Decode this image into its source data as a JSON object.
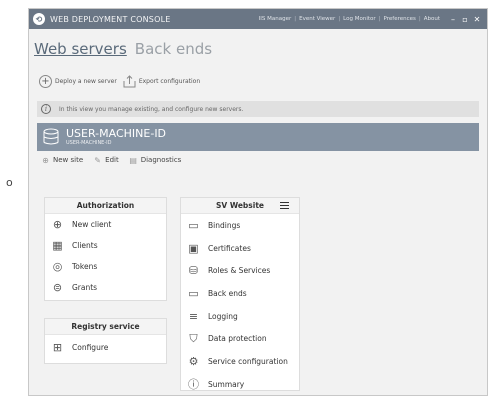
{
  "window": {
    "title": "WEB DEPLOYMENT CONSOLE",
    "top_links": [
      "IIS Manager",
      "Event Viewer",
      "Log Monitor",
      "Preferences",
      "About"
    ],
    "controls": [
      "–",
      "▫",
      "✕"
    ]
  },
  "tabs": [
    {
      "label": "Web servers",
      "active": true
    },
    {
      "label": "Back ends",
      "active": false
    }
  ],
  "toolbar": {
    "deploy_label": "Deploy a new server",
    "export_label": "Export configuration"
  },
  "info": {
    "text": "In this view you manage existing, and configure new servers."
  },
  "machine": {
    "title": "USER-MACHINE-ID",
    "subtitle": "USER-MACHINE-ID"
  },
  "actions": [
    {
      "label": "New site",
      "icon": "plus-circle-icon"
    },
    {
      "label": "Edit",
      "icon": "edit-icon"
    },
    {
      "label": "Diagnostics",
      "icon": "diagnostics-icon"
    }
  ],
  "panels": {
    "authorization": {
      "title": "Authorization",
      "items": [
        {
          "label": "New client",
          "icon": "add-circle-icon"
        },
        {
          "label": "Clients",
          "icon": "grid-icon"
        },
        {
          "label": "Tokens",
          "icon": "token-icon"
        },
        {
          "label": "Grants",
          "icon": "grant-icon"
        }
      ]
    },
    "registry": {
      "title": "Registry service",
      "items": [
        {
          "label": "Configure",
          "icon": "configure-icon"
        }
      ]
    },
    "website": {
      "title": "SV Website",
      "items": [
        {
          "label": "Bindings",
          "icon": "bindings-icon"
        },
        {
          "label": "Certificates",
          "icon": "certificate-icon"
        },
        {
          "label": "Roles & Services",
          "icon": "roles-icon"
        },
        {
          "label": "Back ends",
          "icon": "monitor-icon"
        },
        {
          "label": "Logging",
          "icon": "logging-icon"
        },
        {
          "label": "Data protection",
          "icon": "shield-icon"
        },
        {
          "label": "Service configuration",
          "icon": "gear-icon"
        },
        {
          "label": "Summary",
          "icon": "info-icon"
        }
      ]
    }
  }
}
